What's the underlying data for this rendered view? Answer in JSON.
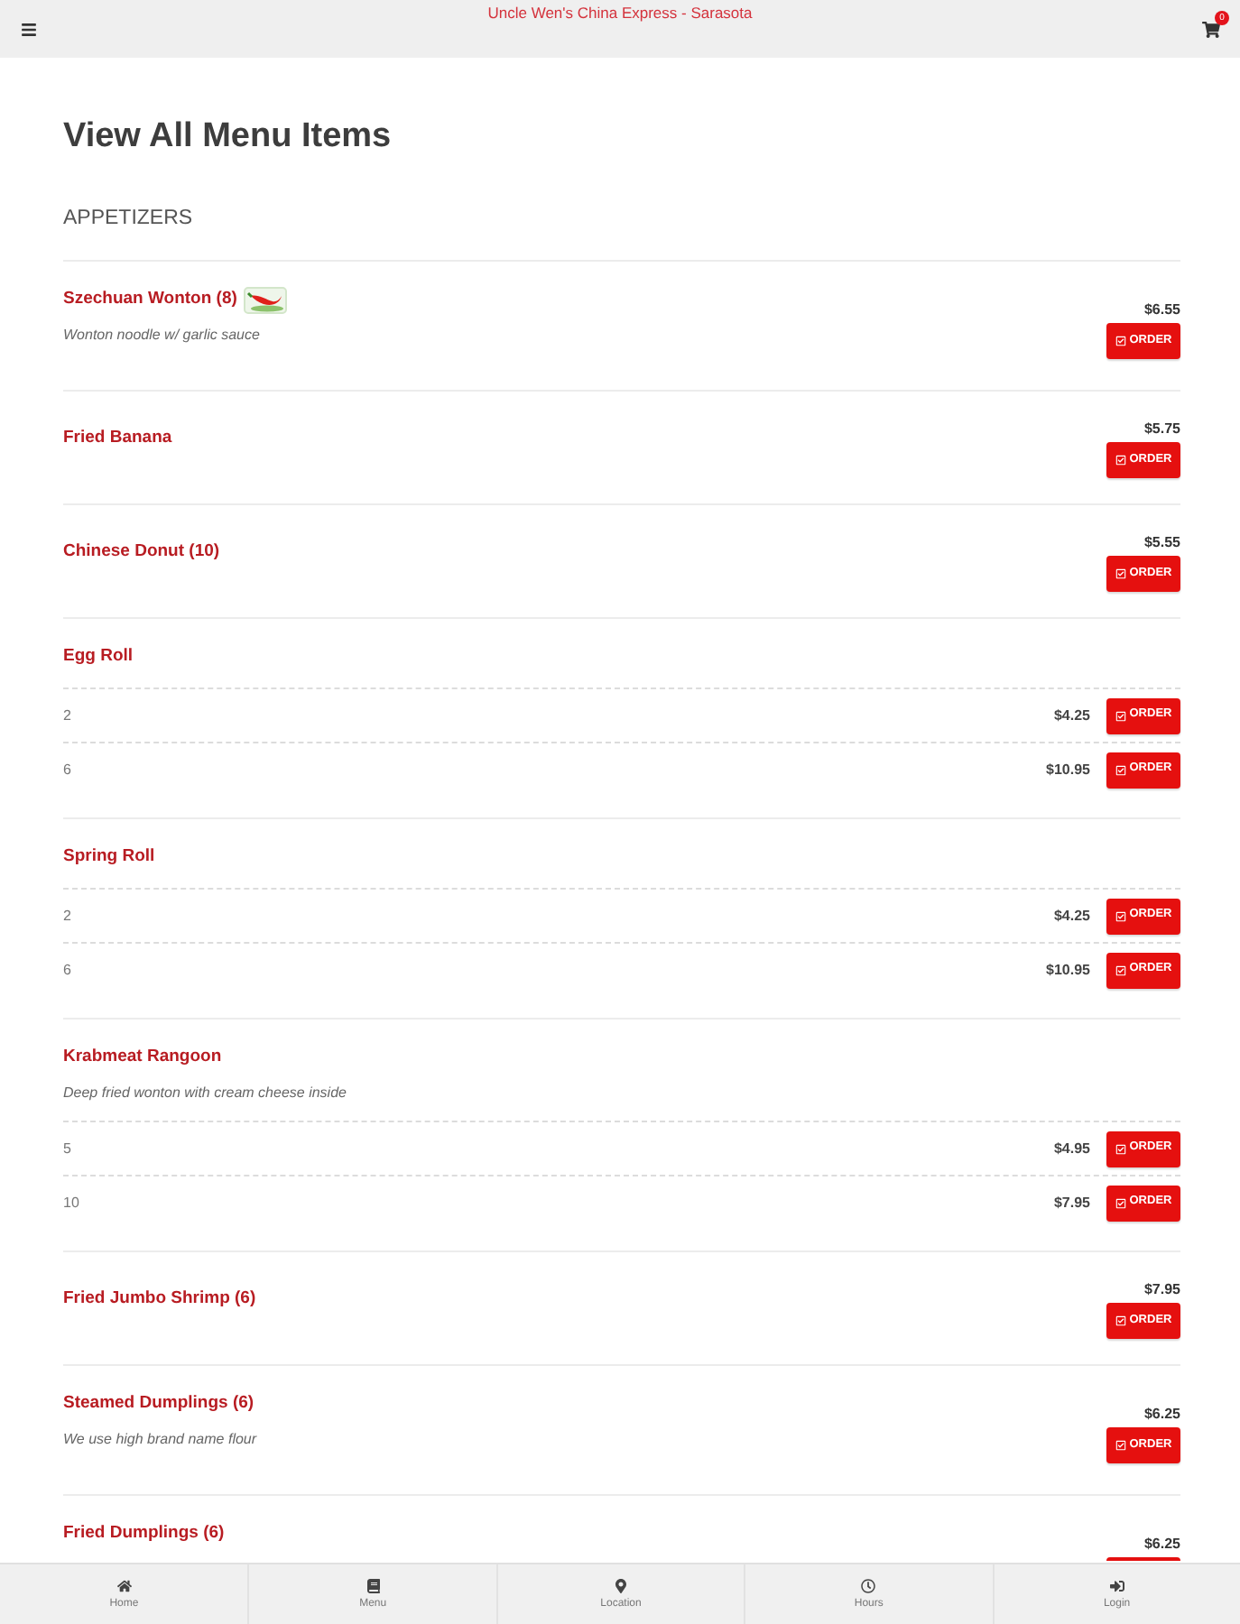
{
  "header": {
    "title": "Uncle Wen's China Express - Sarasota",
    "cart_count": "0"
  },
  "page_title": "View All Menu Items",
  "section": {
    "title": "APPETIZERS",
    "items": [
      {
        "name": "Szechuan Wonton (8)",
        "spicy": true,
        "description": "Wonton noodle w/ garlic sauce",
        "price": "$6.55",
        "order": "ORDER"
      },
      {
        "name": "Fried Banana",
        "price": "$5.75",
        "order": "ORDER"
      },
      {
        "name": "Chinese Donut (10)",
        "price": "$5.55",
        "order": "ORDER"
      },
      {
        "name": "Egg Roll",
        "options": [
          {
            "quantity": "2",
            "price": "$4.25",
            "order": "ORDER"
          },
          {
            "quantity": "6",
            "price": "$10.95",
            "order": "ORDER"
          }
        ]
      },
      {
        "name": "Spring Roll",
        "options": [
          {
            "quantity": "2",
            "price": "$4.25",
            "order": "ORDER"
          },
          {
            "quantity": "6",
            "price": "$10.95",
            "order": "ORDER"
          }
        ]
      },
      {
        "name": "Krabmeat Rangoon",
        "description": "Deep fried wonton with cream cheese inside",
        "options": [
          {
            "quantity": "5",
            "price": "$4.95",
            "order": "ORDER"
          },
          {
            "quantity": "10",
            "price": "$7.95",
            "order": "ORDER"
          }
        ]
      },
      {
        "name": "Fried Jumbo Shrimp (6)",
        "price": "$7.95",
        "order": "ORDER"
      },
      {
        "name": "Steamed Dumplings (6)",
        "description": "We use high brand name flour",
        "price": "$6.25",
        "order": "ORDER"
      },
      {
        "name": "Fried Dumplings (6)",
        "price": "$6.25"
      }
    ]
  },
  "bottom_nav": [
    {
      "label": "Home"
    },
    {
      "label": "Menu"
    },
    {
      "label": "Location"
    },
    {
      "label": "Hours"
    },
    {
      "label": "Login"
    }
  ]
}
